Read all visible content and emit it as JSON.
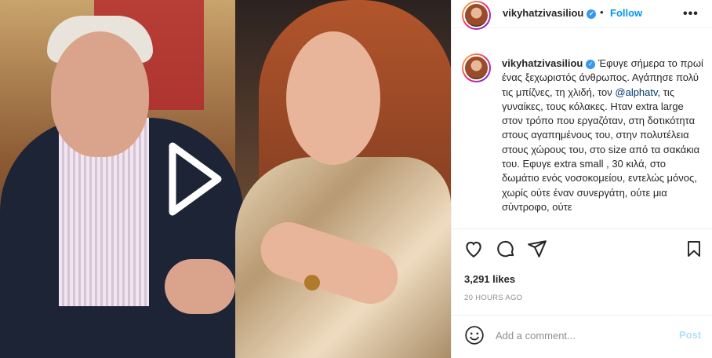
{
  "header": {
    "username": "vikyhatzivasiliou",
    "separator": "•",
    "follow_label": "Follow",
    "more_label": "•••"
  },
  "caption": {
    "username": "vikyhatzivasiliou",
    "text_before_mention": "Έφυγε σήμερα το πρωί ένας ξεχωριστός άνθρωπος. Αγάπησε πολύ τις μπίζνες, τη χλιδή, τον ",
    "mention": "@alphatv",
    "text_after_mention": ", τις γυναίκες, τους κόλακες. Ηταν extra large στον τρόπο που εργαζόταν, στη δοτικότητα στους αγαπημένους του, στην πολυτέλεια στους χώρους του, στο size από τα σακάκια του. Εφυγε extra small , 30 κιλά, στο δωμάτιο ενός νοσοκομείου, εντελώς μόνος, χωρίς ούτε έναν συνεργάτη, ούτε μια σύντροφο, ούτε"
  },
  "stats": {
    "likes": "3,291 likes",
    "time": "20 HOURS AGO"
  },
  "comment_box": {
    "placeholder": "Add a comment...",
    "post_label": "Post"
  },
  "icons": {
    "verified": "verified-badge-icon",
    "like": "heart-icon",
    "comment": "comment-icon",
    "share": "paper-plane-icon",
    "save": "bookmark-icon",
    "emoji": "emoji-icon",
    "play": "play-icon"
  },
  "colors": {
    "accent": "#0095f6",
    "verified": "#3897f0",
    "mention": "#00376b",
    "post_disabled": "#b2dffc",
    "muted": "#8e8e8e"
  }
}
